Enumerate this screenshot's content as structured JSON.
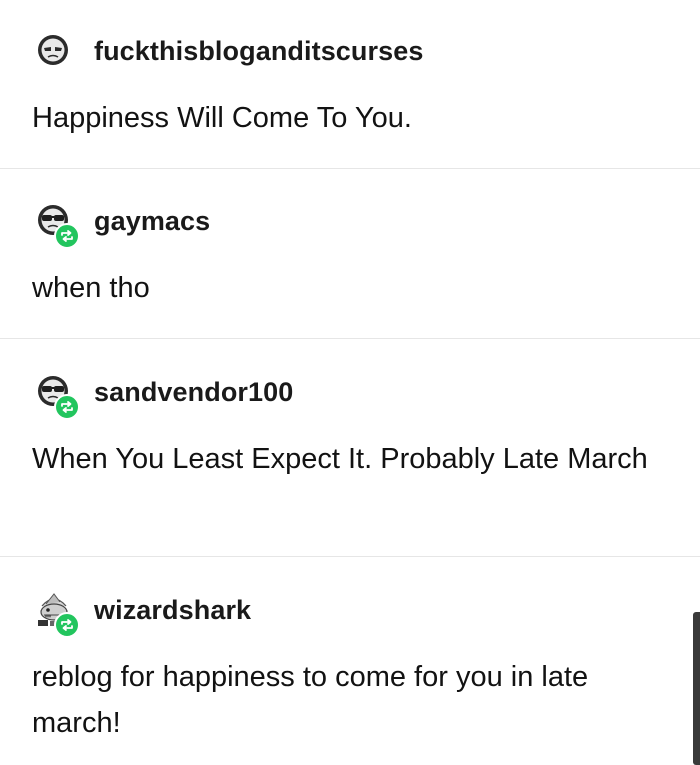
{
  "posts": [
    {
      "username": "fuckthisbloganditscurses",
      "text": "Happiness Will Come To You.",
      "avatar_icon": "grumpy-face-icon",
      "reblog": false
    },
    {
      "username": "gaymacs",
      "text": "when tho",
      "avatar_icon": "sunglasses-face-icon",
      "reblog": true
    },
    {
      "username": "sandvendor100",
      "text": "When You Least Expect It. Probably Late March",
      "avatar_icon": "sunglasses-face-icon",
      "reblog": true
    },
    {
      "username": "wizardshark",
      "text": "reblog for happiness to come for you in late march!",
      "avatar_icon": "wizard-shark-icon",
      "reblog": true
    }
  ],
  "colors": {
    "reblog_badge": "#22c55e",
    "divider": "#e6e6e6",
    "text": "#121212"
  }
}
